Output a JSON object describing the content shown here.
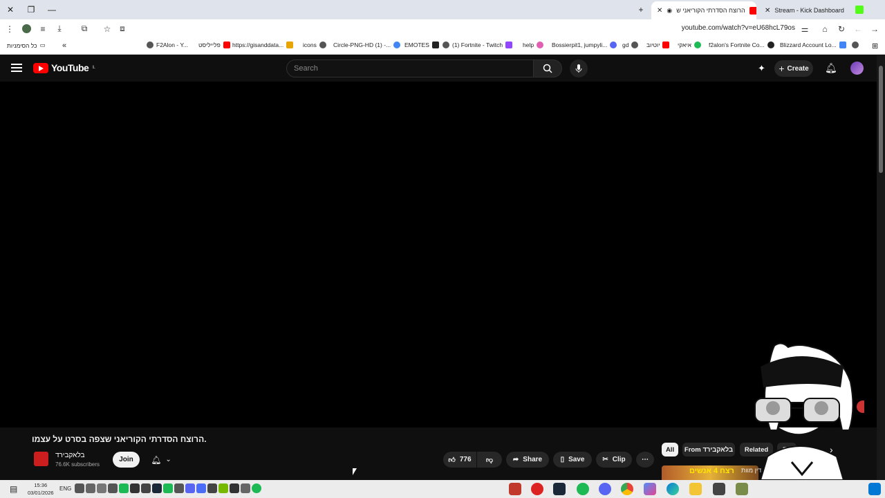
{
  "browser": {
    "tabs": [
      {
        "label": "Stream - Kick Dashboard",
        "favicon_color": "#53fc18"
      },
      {
        "label": "הרוצח הסדרתי הקוריאני ש",
        "favicon_color": "#ff0000"
      }
    ],
    "url": "youtube.com/watch?v=eU68hcL79os",
    "bookmarks_folder": "כל הסימניות",
    "bookmarks": [
      {
        "label": "F2Alon - Y...",
        "color": "#ff0000"
      },
      {
        "label": "פלייליסט",
        "color": "#555555"
      },
      {
        "label": "https://gisanddata...",
        "color": "#555555"
      },
      {
        "label": "icons",
        "color": "#e8a400"
      },
      {
        "label": "Circle-PNG-HD (1) -...",
        "color": "#555555"
      },
      {
        "label": "EMOTES",
        "color": "#4285f4"
      },
      {
        "label": "(1) Fortnite - Twitch",
        "color": "#222222"
      },
      {
        "label": "help",
        "color": "#9146ff"
      },
      {
        "label": "Bossierpit1, jumpyli...",
        "color": "#e05fb2"
      },
      {
        "label": "gd",
        "color": "#5865f2"
      },
      {
        "label": "יוטיוב",
        "color": "#555555"
      },
      {
        "label": "איאקי",
        "color": "#ff0000"
      },
      {
        "label": "f2alon's Fortnite Co...",
        "color": "#1db954"
      },
      {
        "label": "Blizzard Account Lo...",
        "color": "#222222"
      }
    ]
  },
  "youtube": {
    "logo_text": "YouTube",
    "logo_region": "IL",
    "search_placeholder": "Search",
    "create_label": "Create",
    "video": {
      "title": "הרוצח הסדרתי הקוריאני שצפה בסרט על עצמו.",
      "channel_name": "בלאקבירד",
      "subscribers": "76.6K subscribers",
      "join_label": "Join",
      "likes": "776",
      "share_label": "Share",
      "save_label": "Save",
      "clip_label": "Clip"
    },
    "chips": [
      {
        "label": "All",
        "selected": true
      },
      {
        "label": "From בלאקבירד",
        "selected": false
      },
      {
        "label": "Related",
        "selected": false
      },
      {
        "label": "Fo",
        "selected": false
      }
    ],
    "recommend_thumb_text": "רצח 4 אנשים",
    "recommend_title_fragment": "דין מוות"
  },
  "taskbar": {
    "time": "15:36",
    "date": "03/01/2026",
    "lang": "ENG"
  },
  "colors": {
    "accent": "#ff0000",
    "bg": "#0f0f0f"
  }
}
